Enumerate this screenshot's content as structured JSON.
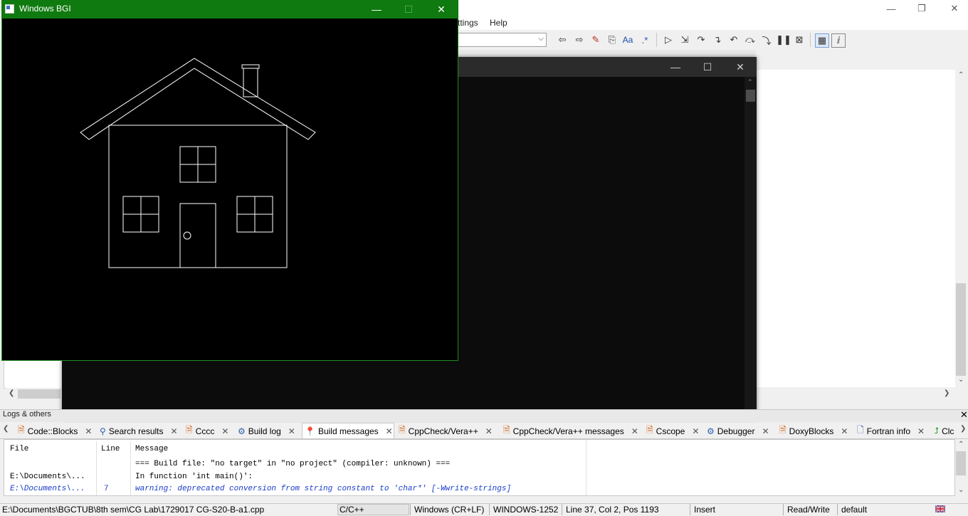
{
  "codeblocks": {
    "window_buttons": {
      "minimize": "—",
      "restore": "❐",
      "close": "✕"
    },
    "menu": [
      "ttings",
      "Help"
    ]
  },
  "console": {
    "buttons": {
      "minimize": "—",
      "maximize": "☐",
      "close": "✕"
    }
  },
  "bgi": {
    "title": "Windows BGI",
    "buttons": {
      "minimize": "—",
      "maximize": "☐",
      "close": "✕"
    }
  },
  "logs": {
    "title": "Logs & others",
    "close": "✕",
    "tabs": [
      {
        "label": "Code::Blocks",
        "icon": "page-icon"
      },
      {
        "label": "Search results",
        "icon": "magnifier-icon"
      },
      {
        "label": "Cccc",
        "icon": "page-icon"
      },
      {
        "label": "Build log",
        "icon": "gear-icon"
      },
      {
        "label": "Build messages",
        "icon": "pin-icon"
      },
      {
        "label": "CppCheck/Vera++",
        "icon": "page-icon"
      },
      {
        "label": "CppCheck/Vera++ messages",
        "icon": "page-icon"
      },
      {
        "label": "Cscope",
        "icon": "page-icon"
      },
      {
        "label": "Debugger",
        "icon": "gear-icon"
      },
      {
        "label": "DoxyBlocks",
        "icon": "page-icon"
      },
      {
        "label": "Fortran info",
        "icon": "document-icon"
      },
      {
        "label": "Clc",
        "icon": "arrow-icon"
      }
    ],
    "columns": {
      "file": "File",
      "line": "Line",
      "message": "Message"
    },
    "rows": [
      {
        "file": "",
        "line": "",
        "message": "=== Build file: \"no target\" in \"no project\" (compiler: unknown) ==="
      },
      {
        "file": "E:\\Documents\\...",
        "line": "",
        "message": "In function 'int main()':"
      },
      {
        "file": "E:\\Documents\\...",
        "line": "7",
        "message": "warning: deprecated conversion from string constant to 'char*' [-Wwrite-strings]"
      }
    ]
  },
  "statusbar": {
    "path": "E:\\Documents\\BGCTUB\\8th sem\\CG Lab\\1729017 CG-S20-B-a1.cpp",
    "language": "C/C++",
    "line_endings": "Windows (CR+LF)",
    "encoding": "WINDOWS-1252",
    "position": "Line 37, Col 2, Pos 1193",
    "mode": "Insert",
    "access": "Read/Write",
    "profile": "default"
  },
  "colors": {
    "bgi_title": "#0f7a0f",
    "console_bg": "#0c0c0c",
    "warning_text": "#1a3cc8"
  }
}
